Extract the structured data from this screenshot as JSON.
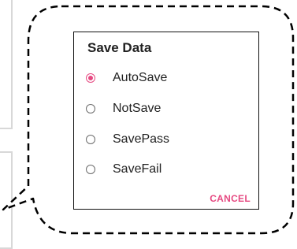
{
  "dialog": {
    "title": "Save Data",
    "options": [
      {
        "label": "AutoSave",
        "selected": true
      },
      {
        "label": "NotSave",
        "selected": false
      },
      {
        "label": "SavePass",
        "selected": false
      },
      {
        "label": "SaveFail",
        "selected": false
      }
    ],
    "cancel_label": "CANCEL"
  },
  "colors": {
    "accent": "#e64a82",
    "callout_outline": "#000000"
  }
}
